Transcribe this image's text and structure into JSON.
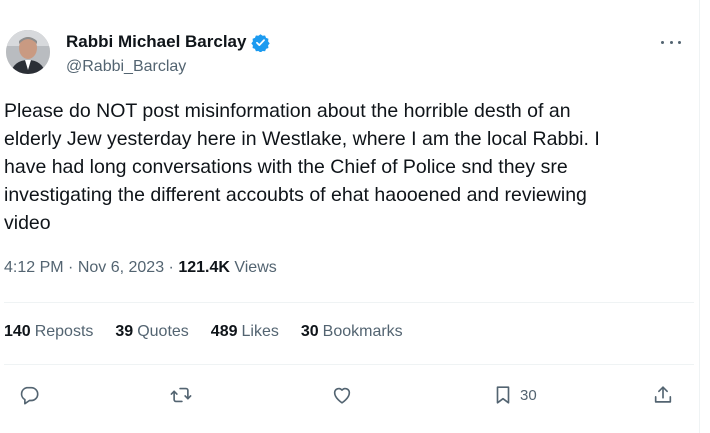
{
  "author": {
    "name": "Rabbi Michael Barclay",
    "handle": "@Rabbi_Barclay",
    "verified_color": "#1d9bf0"
  },
  "tweet": {
    "text": "Please do NOT post misinformation about the horrible desth of an\nelderly Jew yesterday here in Westlake, where I am the local Rabbi.  I\nhave had long conversations with the Chief of Police snd they sre\ninvestigating the different accoubts of ehat haooened and reviewing\nvideo",
    "time": "4:12 PM",
    "date": "Nov 6, 2023",
    "separator": " · ",
    "views_count": "121.4K",
    "views_label": " Views"
  },
  "stats": {
    "reposts_count": "140",
    "reposts_label": "Reposts",
    "quotes_count": "39",
    "quotes_label": "Quotes",
    "likes_count": "489",
    "likes_label": "Likes",
    "bookmarks_count": "30",
    "bookmarks_label": "Bookmarks"
  },
  "actions": {
    "reply_icon": "reply-icon",
    "repost_icon": "repost-icon",
    "like_icon": "heart-icon",
    "bookmark_icon": "bookmark-icon",
    "bookmark_count": "30",
    "share_icon": "share-icon"
  }
}
